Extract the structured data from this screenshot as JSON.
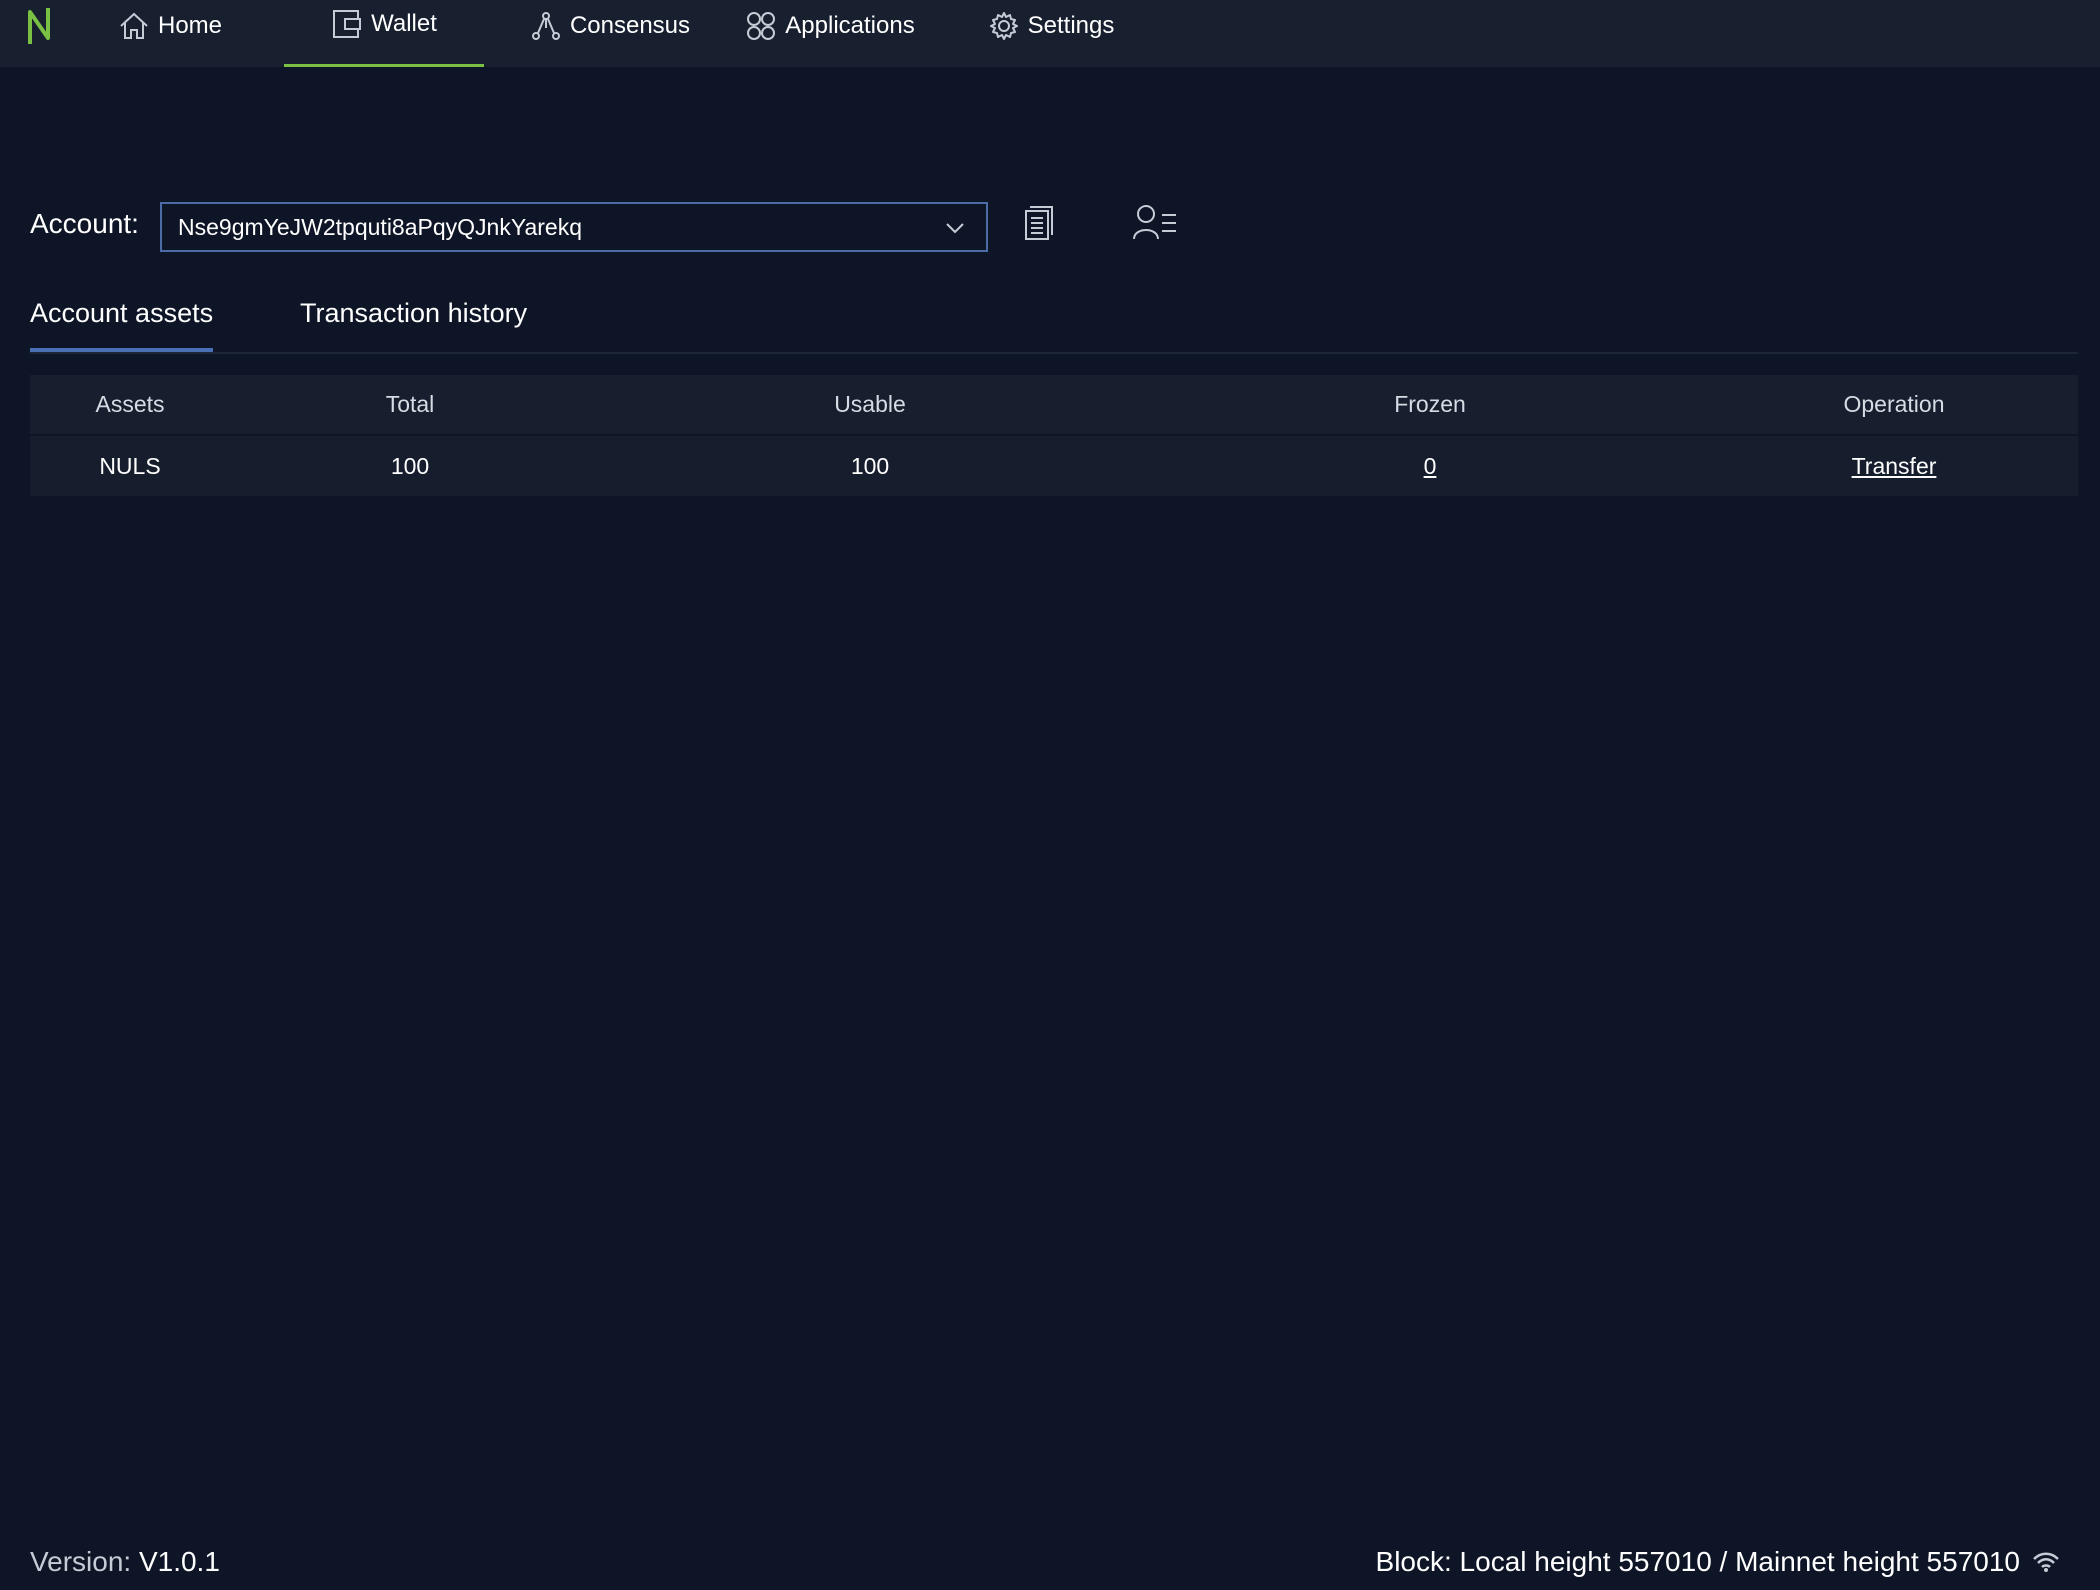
{
  "nav": {
    "home": "Home",
    "wallet": "Wallet",
    "consensus": "Consensus",
    "applications": "Applications",
    "settings": "Settings",
    "active": "wallet"
  },
  "account": {
    "label": "Account:",
    "value": "Nse9gmYeJW2tpquti8aPqyQJnkYarekq"
  },
  "tabs": {
    "assets": "Account assets",
    "history": "Transaction history",
    "active": "assets"
  },
  "table": {
    "headers": [
      "Assets",
      "Total",
      "Usable",
      "Frozen",
      "Operation"
    ],
    "rows": [
      {
        "asset": "NULS",
        "total": "100",
        "usable": "100",
        "frozen": "0",
        "operation": "Transfer"
      }
    ]
  },
  "footer": {
    "version_label": "Version:",
    "version": "V1.0.1",
    "block_text": "Block: Local height 557010 / Mainnet height 557010"
  },
  "colors": {
    "background": "#0e1526",
    "nav_background": "#182030",
    "accent_green": "#7ac143",
    "accent_blue": "#4a6fb5"
  },
  "icons": [
    "nuls-logo-icon",
    "home-icon",
    "wallet-icon",
    "consensus-icon",
    "applications-icon",
    "settings-gear-icon",
    "chevron-down-icon",
    "copy-document-icon",
    "contacts-icon",
    "wifi-icon"
  ]
}
